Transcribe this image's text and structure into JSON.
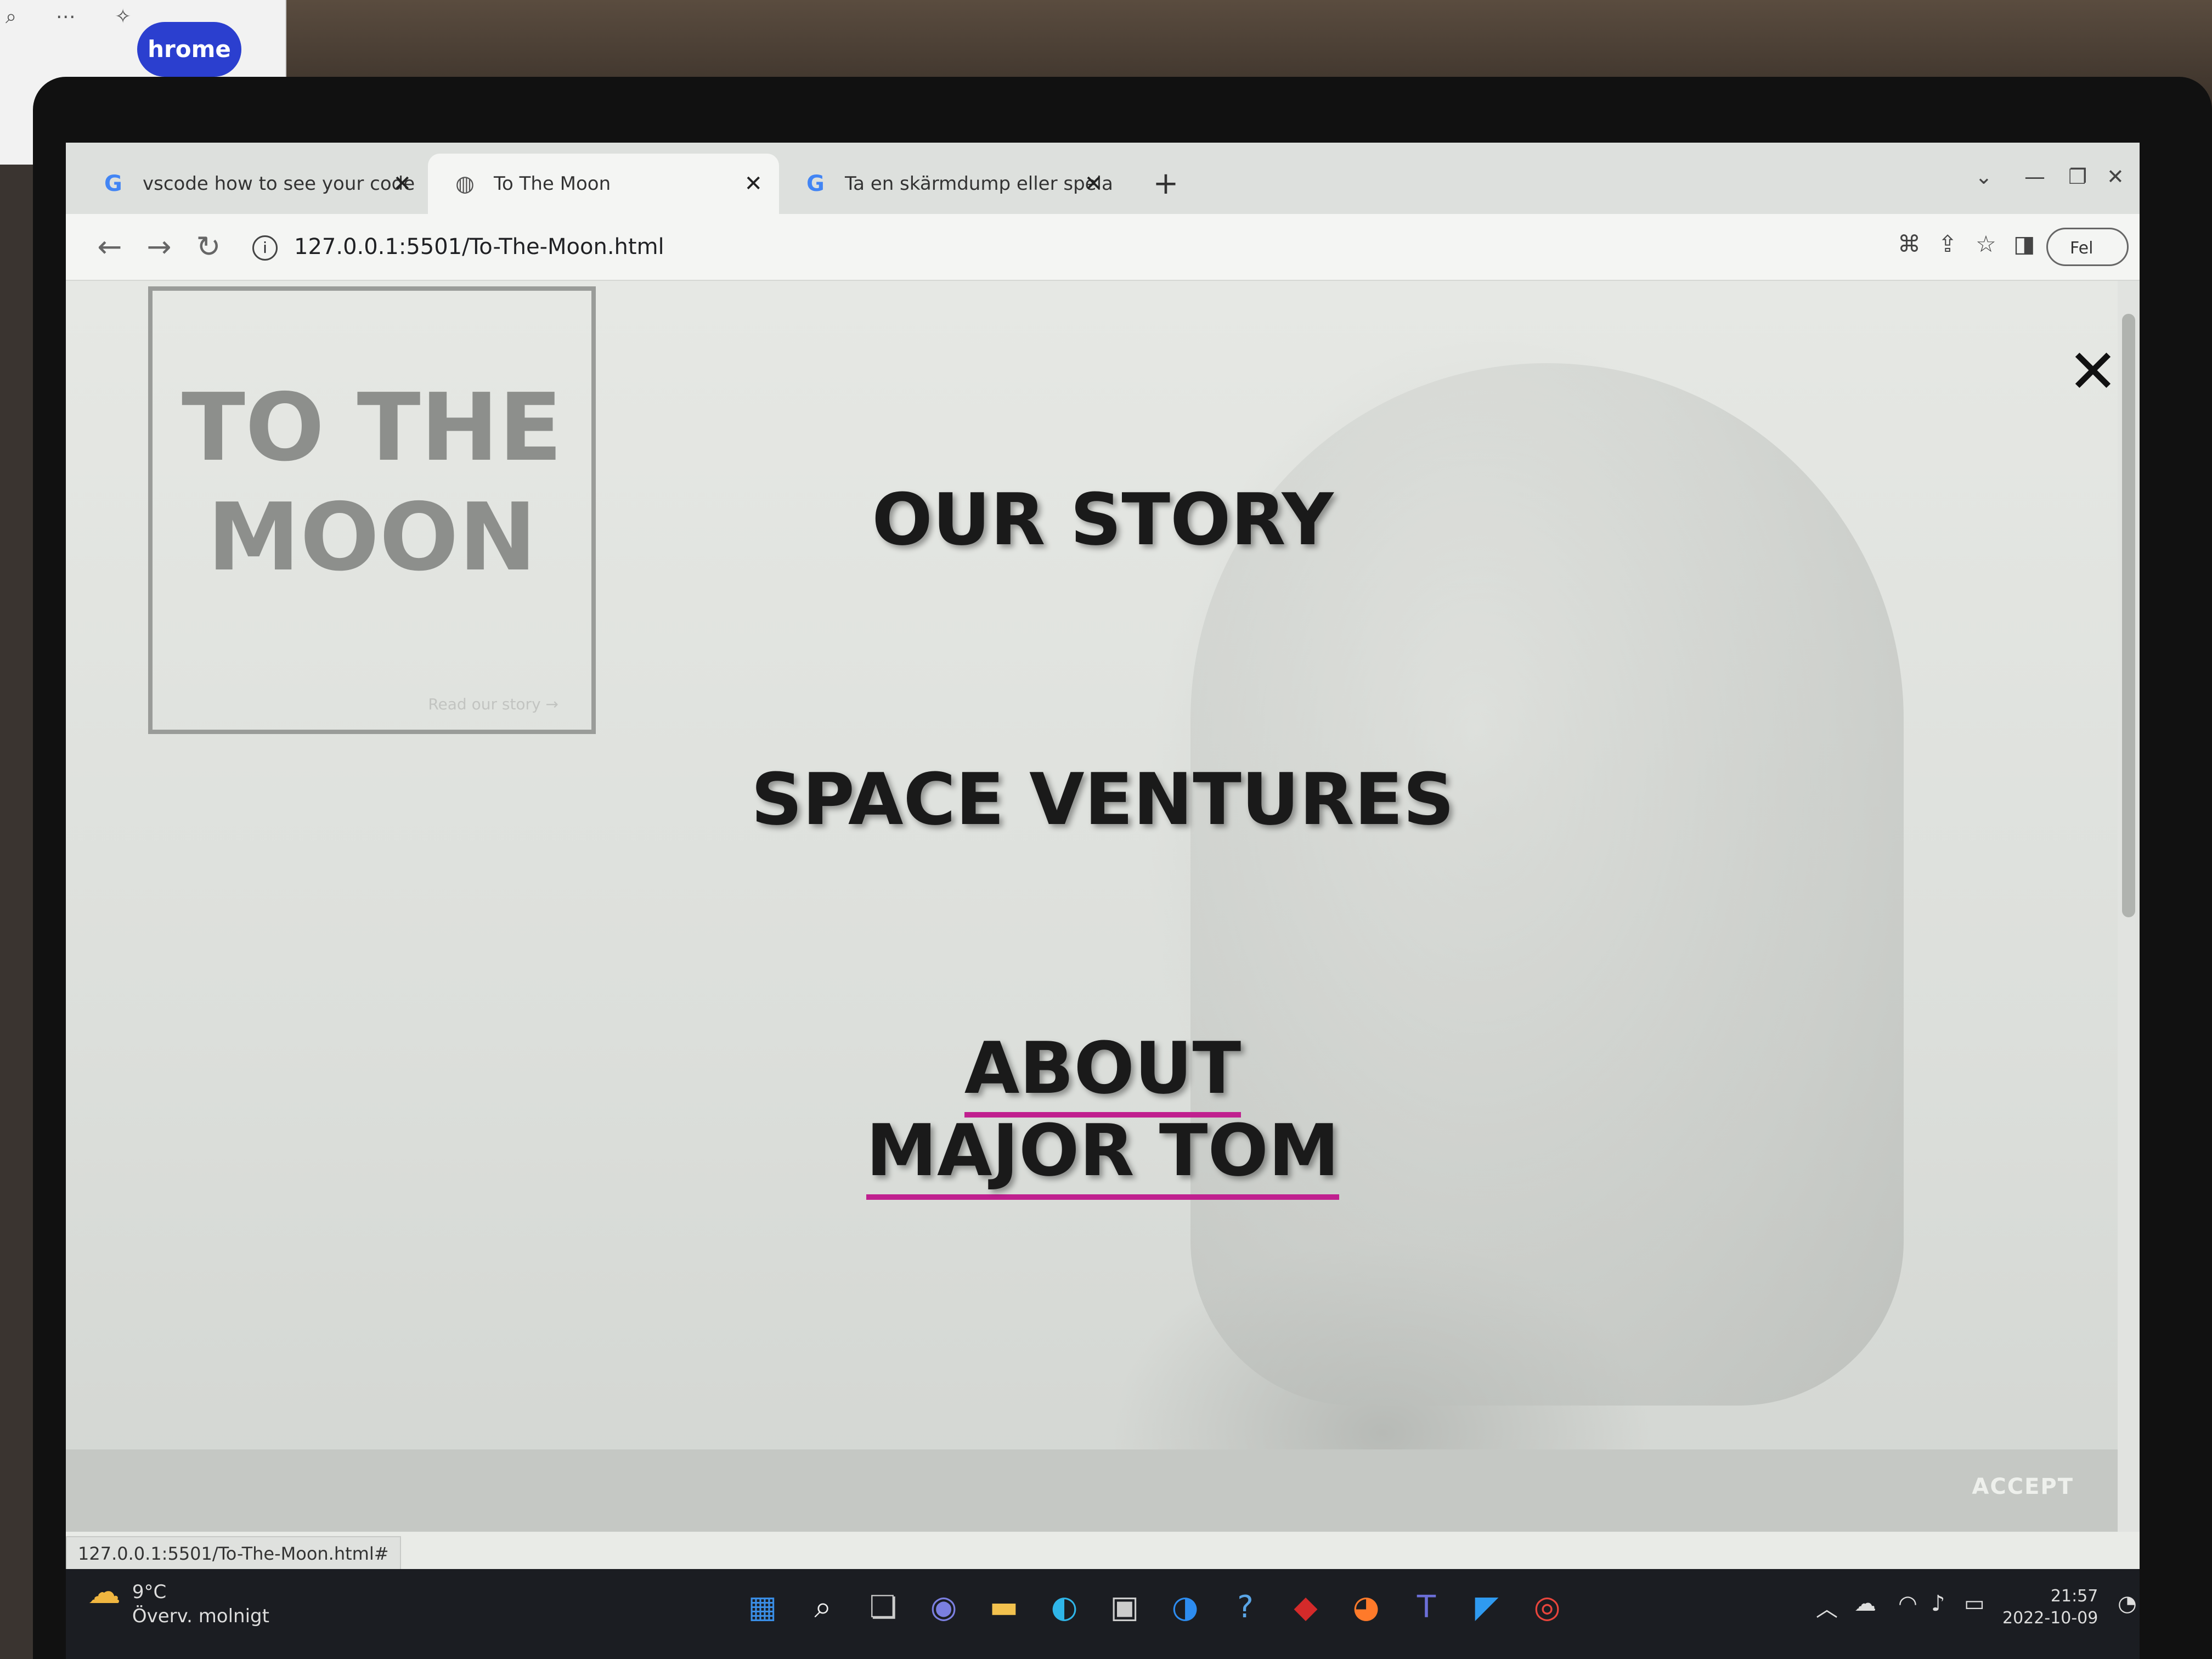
{
  "browser": {
    "tabs": [
      {
        "label": "vscode how to see your code wo",
        "icon": "google-icon"
      },
      {
        "label": "To The Moon",
        "icon": "globe-icon"
      },
      {
        "label": "Ta en skärmdump eller spela in e",
        "icon": "google-icon"
      }
    ],
    "url": "127.0.0.1:5501/To-The-Moon.html",
    "profile_label": "Fel",
    "status_url": "127.0.0.1:5501/To-The-Moon.html#"
  },
  "background_window": {
    "pill_label": "hrome"
  },
  "page": {
    "logo_line1": "TO THE",
    "logo_line2": "MOON",
    "logo_link": "Read our story →",
    "menu": [
      {
        "label": "OUR STORY"
      },
      {
        "label": "SPACE VENTURES"
      },
      {
        "label_line1": "ABOUT",
        "label_line2": "MAJOR TOM"
      }
    ],
    "close_icon": "close-icon",
    "accept_label": "ACCEPT"
  },
  "taskbar": {
    "weather_temp": "9°C",
    "weather_desc": "Överv. molnigt",
    "time": "21:57",
    "date": "2022-10-09"
  },
  "colors": {
    "accent_underline": "#c0208f",
    "menu_text": "#1a1a1a"
  }
}
